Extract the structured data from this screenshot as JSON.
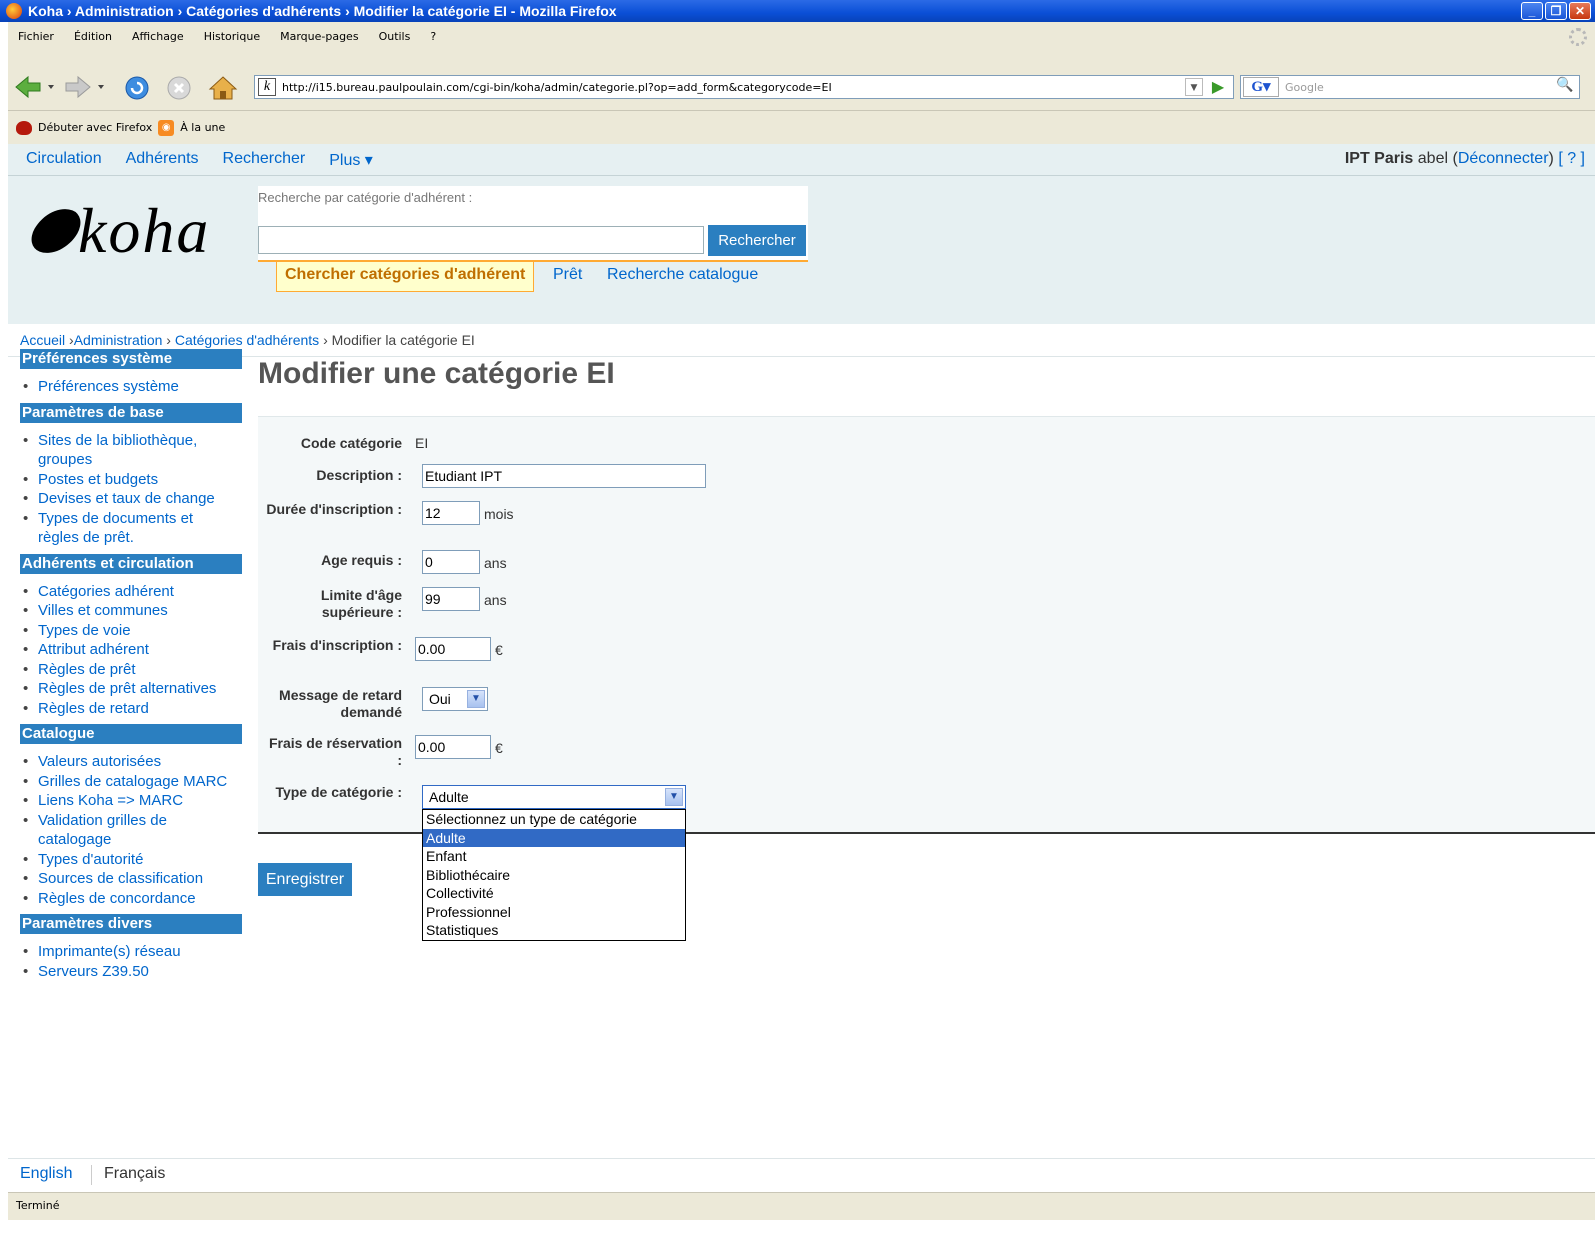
{
  "window": {
    "title": "Koha › Administration › Catégories d'adhérents › Modifier la catégorie EI - Mozilla Firefox",
    "controls": [
      "_",
      "❐",
      "✕"
    ]
  },
  "menubar": [
    "Fichier",
    "Édition",
    "Affichage",
    "Historique",
    "Marque-pages",
    "Outils",
    "?"
  ],
  "navbar": {
    "url": "http://i15.bureau.paulpoulain.com/cgi-bin/koha/admin/categorie.pl?op=add_form&categorycode=EI",
    "search_placeholder": "Google"
  },
  "bookmarks": [
    "Débuter avec Firefox",
    "À la une"
  ],
  "topnav": {
    "links": [
      "Circulation",
      "Adhérents",
      "Rechercher",
      "Plus ▾"
    ],
    "library": "IPT Paris",
    "user": "abel",
    "logout": "Déconnecter",
    "help": "[ ? ]"
  },
  "header": {
    "logo": "koha",
    "search_label": "Recherche par catégorie d'adhérent :",
    "search_button": "Rechercher",
    "tabs": [
      "Chercher catégories d'adhérent",
      "Prêt",
      "Recherche catalogue"
    ]
  },
  "breadcrumbs": {
    "home": "Accueil",
    "admin": "Administration",
    "categories": "Catégories d'adhérents",
    "current": "Modifier la catégorie EI"
  },
  "sidebar": [
    {
      "title": "Préférences système",
      "items": [
        "Préférences système"
      ]
    },
    {
      "title": "Paramètres de base",
      "items": [
        "Sites de la bibliothèque, groupes",
        "Postes et budgets",
        "Devises et taux de change",
        "Types de documents et règles de prêt."
      ]
    },
    {
      "title": "Adhérents et circulation",
      "items": [
        "Catégories adhérent",
        "Villes et communes",
        "Types de voie",
        "Attribut adhérent",
        "Règles de prêt",
        "Règles de prêt alternatives",
        "Règles de retard"
      ]
    },
    {
      "title": "Catalogue",
      "items": [
        "Valeurs autorisées",
        "Grilles de catalogage MARC",
        "Liens Koha => MARC",
        "Validation grilles de catalogage",
        "Types d'autorité",
        "Sources de classification",
        "Règles de concordance"
      ]
    },
    {
      "title": "Paramètres divers",
      "items": [
        "Imprimante(s) réseau",
        "Serveurs Z39.50"
      ]
    }
  ],
  "main": {
    "title": "Modifier une catégorie EI",
    "form": {
      "code_label": "Code catégorie",
      "code_value": "EI",
      "description_label": "Description :",
      "description_value": "Etudiant IPT",
      "duration_label": "Durée d'inscription :",
      "duration_value": "12",
      "duration_unit": "mois",
      "age_label": "Age requis :",
      "age_value": "0",
      "age_unit": "ans",
      "upper_age_label": "Limite d'âge supérieure :",
      "upper_age_value": "99",
      "upper_age_unit": "ans",
      "fee_label": "Frais d'inscription :",
      "fee_value": "0.00",
      "fee_unit": "€",
      "overdue_label": "Message de retard demandé",
      "overdue_value": "Oui",
      "reserve_label": "Frais de réservation :",
      "reserve_value": "0.00",
      "reserve_unit": "€",
      "type_label": "Type de catégorie :",
      "type_value": "Adulte",
      "type_options": [
        "Sélectionnez un type de catégorie",
        "Adulte",
        "Enfant",
        "Bibliothécaire",
        "Collectivité",
        "Professionnel",
        "Statistiques"
      ],
      "type_selected_index": 1
    },
    "save_button": "Enregistrer"
  },
  "footer": {
    "english": "English",
    "french": "Français"
  },
  "status": "Terminé"
}
